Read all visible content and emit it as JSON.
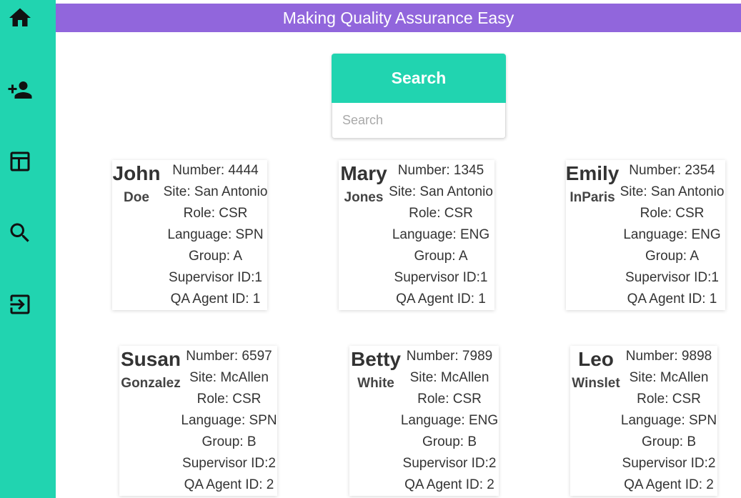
{
  "header": {
    "title": "Making Quality Assurance Easy"
  },
  "sidebar": {
    "items": [
      {
        "icon": "home-icon"
      },
      {
        "icon": "add-user-icon"
      },
      {
        "icon": "table-icon"
      },
      {
        "icon": "search-icon"
      },
      {
        "icon": "logout-icon"
      }
    ]
  },
  "search": {
    "button_label": "Search",
    "placeholder": "Search",
    "value": ""
  },
  "colors": {
    "sidebar": "#21d4b0",
    "banner": "#9166dc",
    "button": "#21d4b0"
  },
  "agents": [
    {
      "first": "John",
      "last": "Doe",
      "number": "Number: 4444",
      "site": "Site: San Antonio",
      "role": "Role: CSR",
      "language": "Language: SPN",
      "group": "Group: A",
      "supervisor": "Supervisor ID:1",
      "qa_agent": "QA Agent ID: 1"
    },
    {
      "first": "Mary",
      "last": "Jones",
      "number": "Number: 1345",
      "site": "Site: San Antonio",
      "role": "Role: CSR",
      "language": "Language: ENG",
      "group": "Group: A",
      "supervisor": "Supervisor ID:1",
      "qa_agent": "QA Agent ID: 1"
    },
    {
      "first": "Emily",
      "last": "InParis",
      "number": "Number: 2354",
      "site": "Site: San Antonio",
      "role": "Role: CSR",
      "language": "Language: ENG",
      "group": "Group: A",
      "supervisor": "Supervisor ID:1",
      "qa_agent": "QA Agent ID: 1"
    },
    {
      "first": "Susan",
      "last": "Gonzalez",
      "number": "Number: 6597",
      "site": "Site: McAllen",
      "role": "Role: CSR",
      "language": "Language: SPN",
      "group": "Group: B",
      "supervisor": "Supervisor ID:2",
      "qa_agent": "QA Agent ID: 2"
    },
    {
      "first": "Betty",
      "last": "White",
      "number": "Number: 7989",
      "site": "Site: McAllen",
      "role": "Role: CSR",
      "language": "Language: ENG",
      "group": "Group: B",
      "supervisor": "Supervisor ID:2",
      "qa_agent": "QA Agent ID: 2"
    },
    {
      "first": "Leo",
      "last": "Winslet",
      "number": "Number: 9898",
      "site": "Site: McAllen",
      "role": "Role: CSR",
      "language": "Language: SPN",
      "group": "Group: B",
      "supervisor": "Supervisor ID:2",
      "qa_agent": "QA Agent ID: 2"
    }
  ]
}
